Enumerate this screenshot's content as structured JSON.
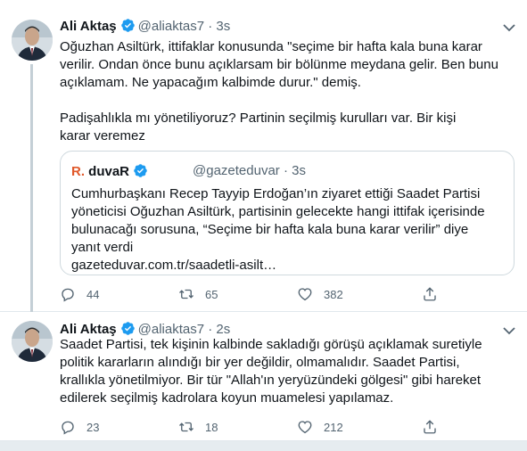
{
  "tweets": [
    {
      "author": {
        "name": "Ali Aktaş",
        "handle": "@aliaktas7",
        "time": "3s"
      },
      "paragraph1": "Oğuzhan Asiltürk, ittifaklar konusunda \"seçime bir hafta kala buna karar verilir. Ondan önce bunu açıklarsam bir bölünme meydana gelir. Ben bunu açıklamam. Ne yapacağım kalbimde durur.\" demiş.",
      "paragraph2": "Padişahlıkla mı yönetiliyoruz? Partinin seçilmiş kurulları var. Bir kişi karar veremez",
      "quote": {
        "logo_mark": "R.",
        "logo_text": "duvaR",
        "handle": "@gazeteduvar",
        "time": "3s",
        "text": "Cumhurbaşkanı Recep Tayyip Erdoğan’ın ziyaret ettiği Saadet Partisi yöneticisi Oğuzhan Asiltürk, partisinin gelecekte hangi ittifak içerisinde bulunacağı sorusuna, “Seçime bir hafta kala buna karar verilir” diye yanıt verdi",
        "link": "gazeteduvar.com.tr/saadetli-asilt…"
      },
      "actions": {
        "replies": "44",
        "retweets": "65",
        "likes": "382"
      }
    },
    {
      "author": {
        "name": "Ali Aktaş",
        "handle": "@aliaktas7",
        "time": "2s"
      },
      "paragraph1": "Saadet Partisi, tek kişinin kalbinde sakladığı görüşü açıklamak suretiyle politik kararların alındığı bir yer değildir, olmamalıdır. Saadet Partisi, krallıkla yönetilmiyor. Bir tür \"Allah'ın yeryüzündeki gölgesi\" gibi hareket edilerek seçilmiş kadrolara koyun muamelesi yapılamaz.",
      "actions": {
        "replies": "23",
        "retweets": "18",
        "likes": "212"
      }
    }
  ],
  "separator": "·",
  "colors": {
    "verified": "#1d9bf0",
    "secondary": "#536471",
    "border": "#cfd9de",
    "duvar_accent": "#e0582a"
  },
  "icons": [
    "verified-badge-icon",
    "chevron-down-icon",
    "reply-icon",
    "retweet-icon",
    "like-icon",
    "share-icon"
  ]
}
